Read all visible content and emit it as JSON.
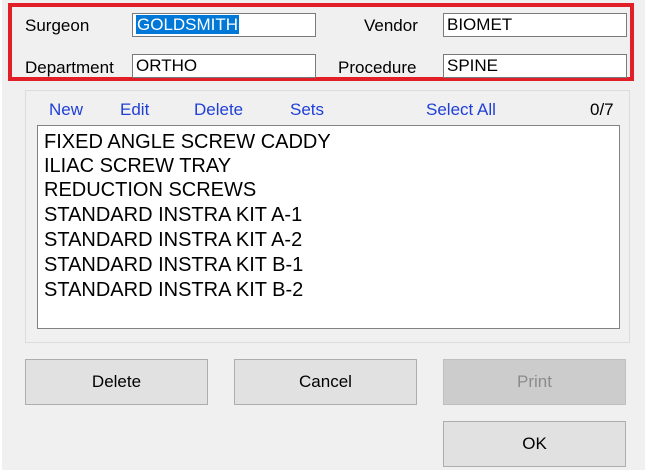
{
  "header": {
    "surgeon_label": "Surgeon",
    "surgeon_value": "GOLDSMITH",
    "vendor_label": "Vendor",
    "vendor_value": "BIOMET",
    "department_label": "Department",
    "department_value": "ORTHO",
    "procedure_label": "Procedure",
    "procedure_value": "SPINE"
  },
  "toolbar": {
    "new_label": "New",
    "edit_label": "Edit",
    "delete_label": "Delete",
    "sets_label": "Sets",
    "select_all_label": "Select All",
    "count_text": "0/7"
  },
  "items": [
    "FIXED ANGLE SCREW CADDY",
    "ILIAC SCREW TRAY",
    "REDUCTION SCREWS",
    "STANDARD INSTRA KIT A-1",
    "STANDARD INSTRA KIT A-2",
    "STANDARD INSTRA KIT B-1",
    "STANDARD INSTRA KIT B-2"
  ],
  "buttons": {
    "delete_label": "Delete",
    "cancel_label": "Cancel",
    "print_label": "Print",
    "ok_label": "OK"
  },
  "colors": {
    "highlight_border": "#e21f26",
    "link": "#1f3fd6",
    "selection": "#0078d7"
  }
}
